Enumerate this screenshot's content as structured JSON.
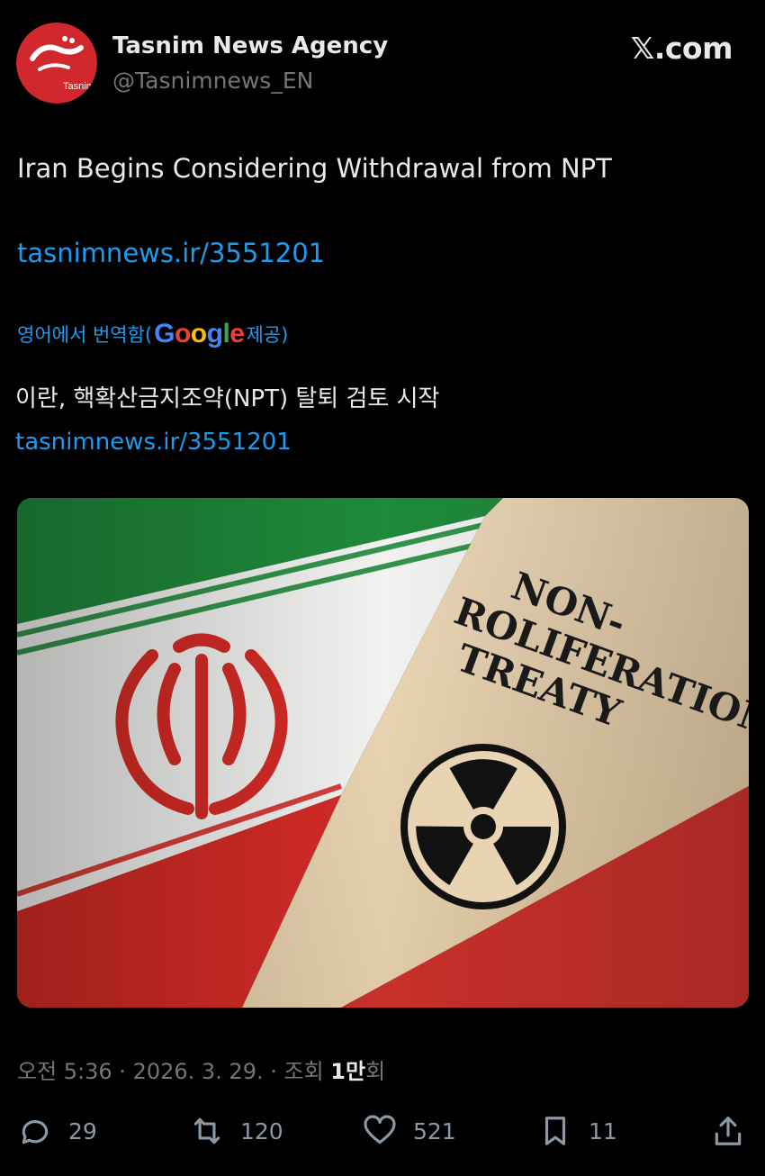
{
  "author": {
    "name": "Tasnim News Agency",
    "handle": "@Tasnimnews_EN",
    "avatar_icon": "tasnim-logo-icon",
    "avatar_text": "Tasnim"
  },
  "watermark": "𝕏.com",
  "post": {
    "text": "Iran Begins Considering Withdrawal from NPT",
    "link": "tasnimnews.ir/3551201"
  },
  "translation": {
    "prefix": "영어에서 번역함(",
    "provider_letters": [
      "G",
      "o",
      "o",
      "g",
      "l",
      "e"
    ],
    "suffix": " 제공)",
    "text": "이란, 핵확산금지조약(NPT) 탈퇴 검토 시작",
    "link": "tasnimnews.ir/3551201"
  },
  "media": {
    "doc_line1": "NON-",
    "doc_line2": "ROLIFERATION",
    "doc_line3": "TREATY",
    "icons": [
      "iran-emblem-icon",
      "radiation-symbol-icon"
    ]
  },
  "meta": {
    "time_date": "오전 5:36 · 2026. 3. 29. · 조회 ",
    "views": "1만",
    "views_suffix": "회"
  },
  "actions": {
    "replies": "29",
    "reposts": "120",
    "likes": "521",
    "bookmarks": "11"
  },
  "colors": {
    "link": "#1d9bf0",
    "secondary": "#71767b",
    "flag_green": "#239f40",
    "flag_red": "#da0000"
  }
}
